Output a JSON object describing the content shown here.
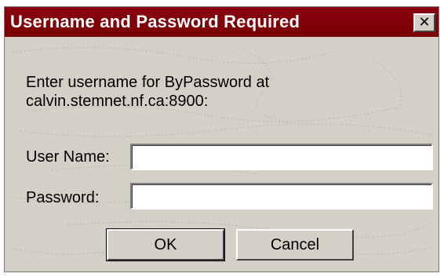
{
  "dialog": {
    "title": "Username and Password Required",
    "close_glyph": "✕",
    "message_line1": "Enter username for ByPassword at",
    "message_line2": "calvin.stemnet.nf.ca:8900:",
    "username_label": "User Name:",
    "username_value": "",
    "password_label": "Password:",
    "password_value": "",
    "ok_label": "OK",
    "cancel_label": "Cancel"
  },
  "colors": {
    "titlebar": "#800000",
    "face": "#d4d0c8",
    "field": "#ffffff"
  },
  "icons": {
    "close": "close-icon"
  }
}
